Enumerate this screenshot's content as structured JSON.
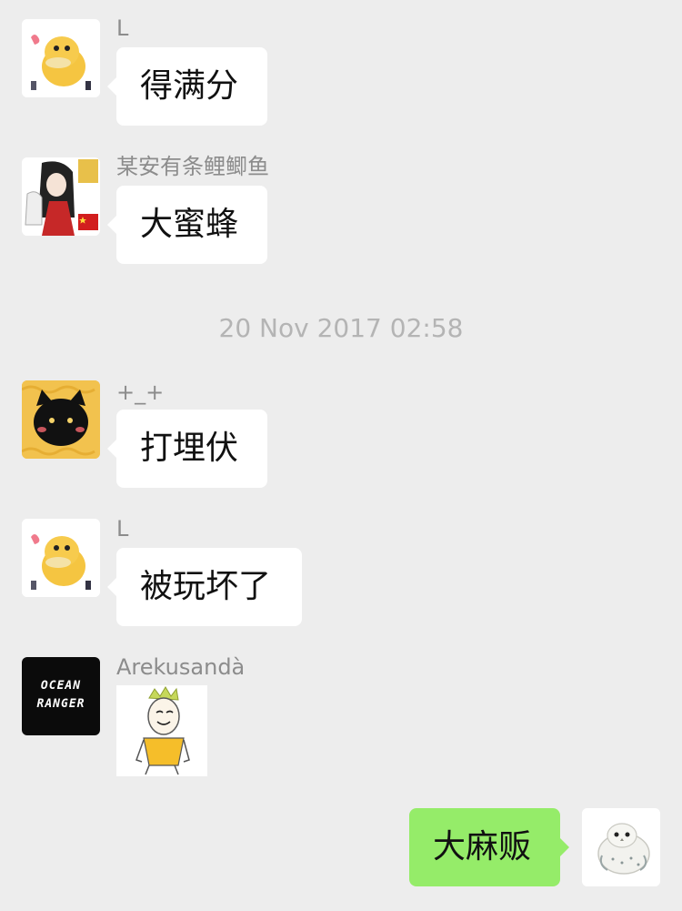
{
  "messages": [
    {
      "sender": "L",
      "text": "得满分"
    },
    {
      "sender": "某安有条鲤鲫鱼",
      "text": "大蜜蜂"
    },
    {
      "sender": "+_+",
      "text": "打埋伏"
    },
    {
      "sender": "L",
      "text": "被玩坏了"
    },
    {
      "sender": "Arekusandà",
      "sticker": "meme-sticker-icon"
    },
    {
      "sender": "self",
      "text": "大麻贩"
    }
  ],
  "timestamp": "20 Nov 2017 02:58",
  "avatars": {
    "ocean_ranger_line1": "OCEAN",
    "ocean_ranger_line2": "RANGER"
  },
  "colors": {
    "background": "#EDEDED",
    "incoming_bubble": "#FFFFFF",
    "outgoing_bubble": "#95EC69",
    "sender_name": "#8C8C8C",
    "timestamp": "#B4B4B4"
  }
}
